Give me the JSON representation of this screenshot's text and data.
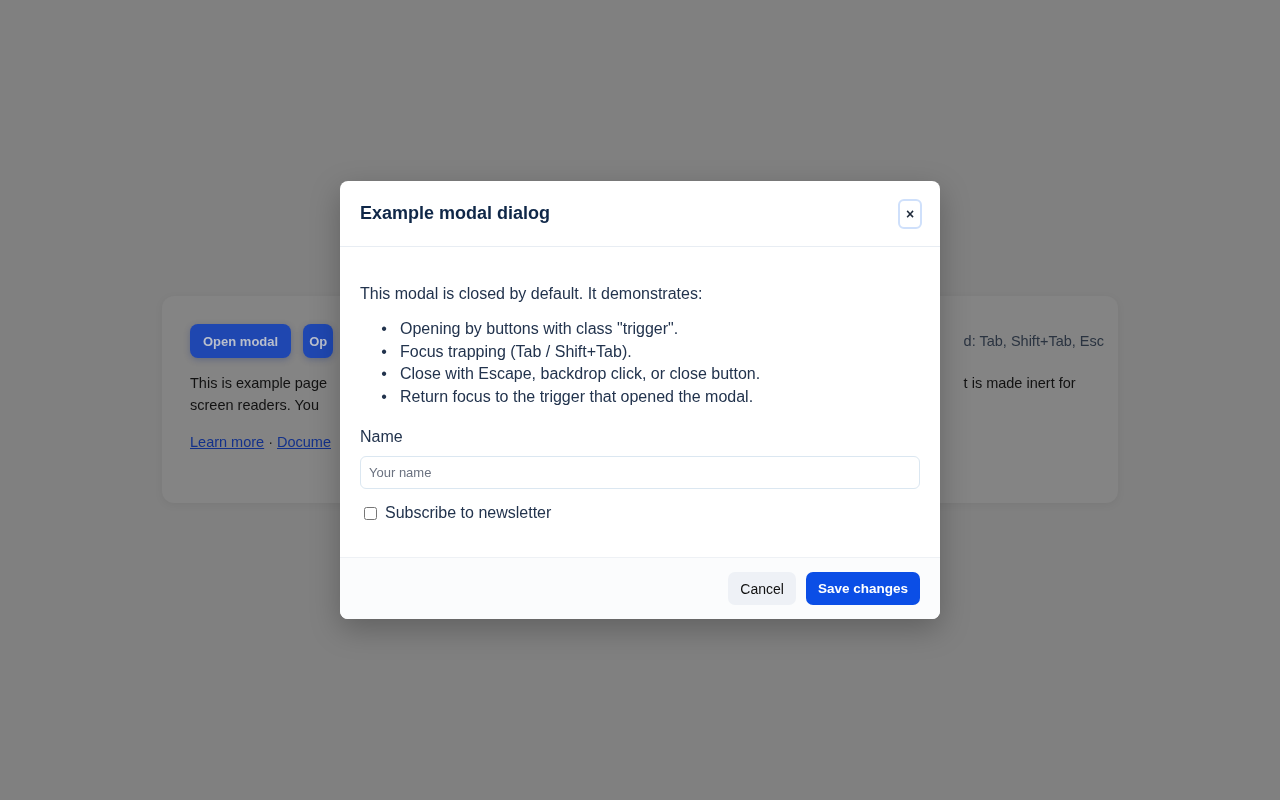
{
  "page": {
    "buttons": [
      "Open modal",
      "Op"
    ],
    "left_lines": [
      "This is example page",
      "screen readers. You"
    ],
    "links": [
      {
        "label": "Learn more"
      },
      {
        "label": "Docume"
      }
    ],
    "link_separator": "·",
    "right_lines": [
      "d: Tab, Shift+Tab, Esc",
      "t is made inert for"
    ]
  },
  "modal": {
    "title": "Example modal dialog",
    "close": "×",
    "intro": "This modal is closed by default. It demonstrates:",
    "bullet_marker": "•",
    "bullets": [
      "Opening by buttons with class \"trigger\".",
      "Focus trapping (Tab / Shift+Tab).",
      "Close with Escape, backdrop click, or close button.",
      "Return focus to the trigger that opened the modal."
    ],
    "name_label": "Name",
    "name_placeholder": "Your name",
    "checkbox": {
      "label": "Subscribe to newsletter",
      "checked": false
    },
    "buttons": [
      {
        "label": "Cancel",
        "kind": "secondary"
      },
      {
        "label": "Save changes",
        "kind": "primary"
      }
    ]
  }
}
